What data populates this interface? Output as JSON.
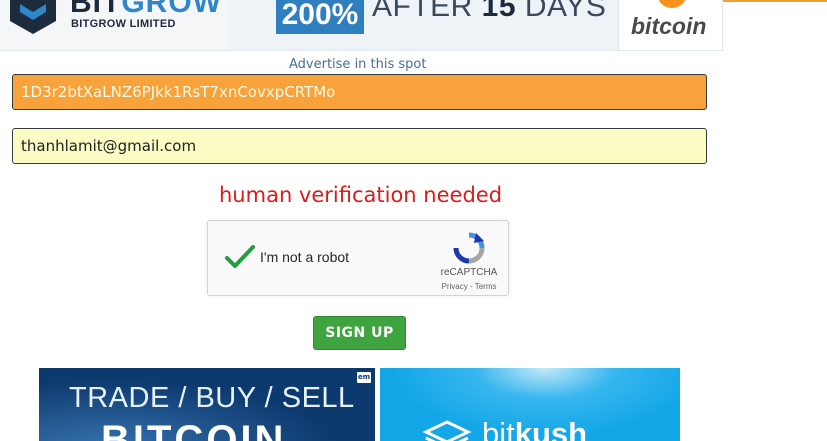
{
  "top_banner": {
    "brand_part1": "BIT",
    "brand_part2": "GROW",
    "company": "BITGROW LIMITED",
    "percent": "200%",
    "offer_prefix": "AFTER ",
    "offer_days_num": "15",
    "offer_suffix": " DAYS",
    "coin_word": "bitcoin"
  },
  "advertise_link": "Advertise in this spot",
  "form": {
    "address_value": "1D3r2btXaLNZ6PJkk1RsT7xnCovxpCRTMo",
    "email_value": "thanhlamit@gmail.com"
  },
  "verification_message": "human verification needed",
  "recaptcha": {
    "label": "I'm not a robot",
    "brand": "reCAPTCHA",
    "links": "Privacy - Terms"
  },
  "signup_label": "SIGN UP",
  "bottom_ads": {
    "left_line1": "TRADE / BUY / SELL",
    "left_line2": "BITCOIN",
    "left_badge": "em",
    "right_word_a": "bit",
    "right_word_b": "kush"
  },
  "colors": {
    "address_bg": "#f7a23a",
    "email_bg": "#fbfcc4",
    "error_text": "#dd1b1b",
    "signup_bg": "#3fa33f",
    "check_green": "#1e9e3e"
  }
}
